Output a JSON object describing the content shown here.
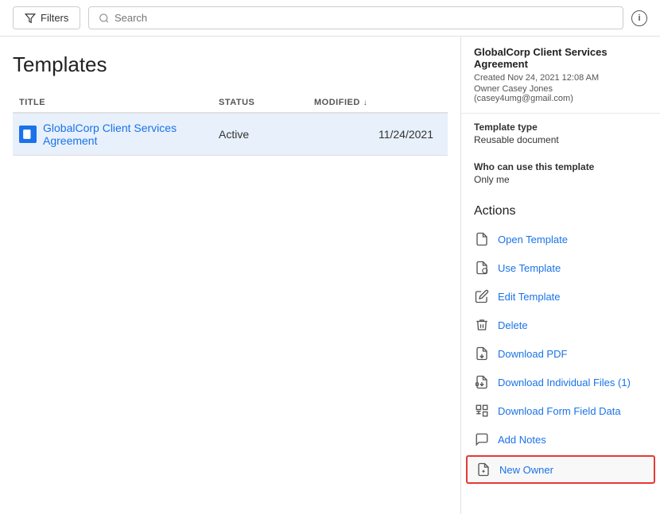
{
  "topbar": {
    "filter_label": "Filters",
    "search_placeholder": "Search",
    "info_label": "i"
  },
  "left": {
    "page_title": "Templates",
    "columns": {
      "title": "TITLE",
      "status": "STATUS",
      "modified": "MODIFIED"
    },
    "rows": [
      {
        "title": "GlobalCorp Client Services Agreement",
        "status": "Active",
        "date": "11/24/2021"
      }
    ]
  },
  "right": {
    "title": "GlobalCorp Client Services Agreement",
    "created": "Created Nov 24, 2021 12:08 AM",
    "owner": "Owner Casey Jones (casey4umg@gmail.com)",
    "template_type_label": "Template type",
    "template_type_value": "Reusable document",
    "who_label": "Who can use this template",
    "who_value": "Only me",
    "actions_label": "Actions",
    "actions": [
      {
        "id": "open-template",
        "label": "Open Template",
        "icon": "file"
      },
      {
        "id": "use-template",
        "label": "Use Template",
        "icon": "file-use"
      },
      {
        "id": "edit-template",
        "label": "Edit Template",
        "icon": "pencil"
      },
      {
        "id": "delete",
        "label": "Delete",
        "icon": "trash"
      },
      {
        "id": "download-pdf",
        "label": "Download PDF",
        "icon": "download-file"
      },
      {
        "id": "download-individual",
        "label": "Download Individual Files (1)",
        "icon": "download-files"
      },
      {
        "id": "download-form",
        "label": "Download Form Field Data",
        "icon": "download-data"
      },
      {
        "id": "add-notes",
        "label": "Add Notes",
        "icon": "notes"
      },
      {
        "id": "new-owner",
        "label": "New Owner",
        "icon": "new-owner",
        "highlighted": true
      }
    ]
  }
}
